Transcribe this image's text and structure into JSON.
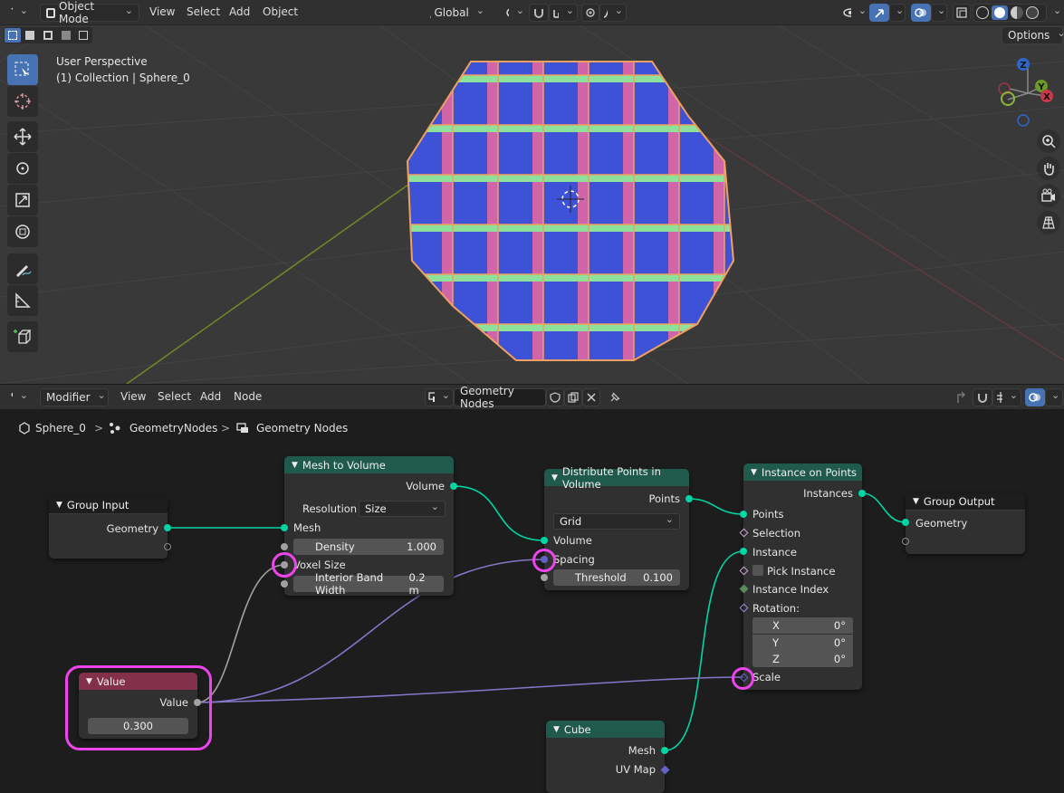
{
  "header": {
    "mode": "Object Mode",
    "menus": [
      "View",
      "Select",
      "Add",
      "Object"
    ],
    "orientation": "Global",
    "options_label": "Options"
  },
  "viewport": {
    "line1": "User Perspective",
    "line2": "(1) Collection | Sphere_0",
    "gizmo": {
      "z": "Z",
      "y": "Y",
      "x": "X"
    }
  },
  "node_editor": {
    "editor_type": "Modifier",
    "menus": [
      "View",
      "Select",
      "Add",
      "Node"
    ],
    "tree_name": "Geometry Nodes",
    "breadcrumb": [
      "Sphere_0",
      "GeometryNodes",
      "Geometry Nodes"
    ]
  },
  "nodes": {
    "group_input": {
      "title": "Group Input",
      "geometry": "Geometry"
    },
    "mesh_to_volume": {
      "title": "Mesh to Volume",
      "volume": "Volume",
      "resolution_label": "Resolution",
      "resolution_value": "Size",
      "mesh": "Mesh",
      "density_label": "Density",
      "density_value": "1.000",
      "voxel_size": "Voxel Size",
      "band_label": "Interior Band Width",
      "band_value": "0.2 m"
    },
    "distribute": {
      "title": "Distribute Points in Volume",
      "points": "Points",
      "mode": "Grid",
      "volume": "Volume",
      "spacing": "Spacing",
      "threshold_label": "Threshold",
      "threshold_value": "0.100"
    },
    "instance_on_points": {
      "title": "Instance on Points",
      "instances": "Instances",
      "points": "Points",
      "selection": "Selection",
      "instance": "Instance",
      "pick_instance": "Pick Instance",
      "instance_index": "Instance Index",
      "rotation": "Rotation:",
      "rot_x_label": "X",
      "rot_x": "0°",
      "rot_y_label": "Y",
      "rot_y": "0°",
      "rot_z_label": "Z",
      "rot_z": "0°",
      "scale": "Scale"
    },
    "group_output": {
      "title": "Group Output",
      "geometry": "Geometry"
    },
    "value": {
      "title": "Value",
      "output": "Value",
      "value": "0.300"
    },
    "cube": {
      "title": "Cube",
      "mesh": "Mesh",
      "uv_map": "UV Map"
    }
  },
  "colors": {
    "geometry_header": "#1f5a4d",
    "value_header": "#83314a",
    "geometry_socket": "#00d6a3",
    "float_socket": "#a1a1a1",
    "vector_socket": "#6363c7",
    "highlight": "#ee44ee",
    "accent": "#4772b3"
  }
}
